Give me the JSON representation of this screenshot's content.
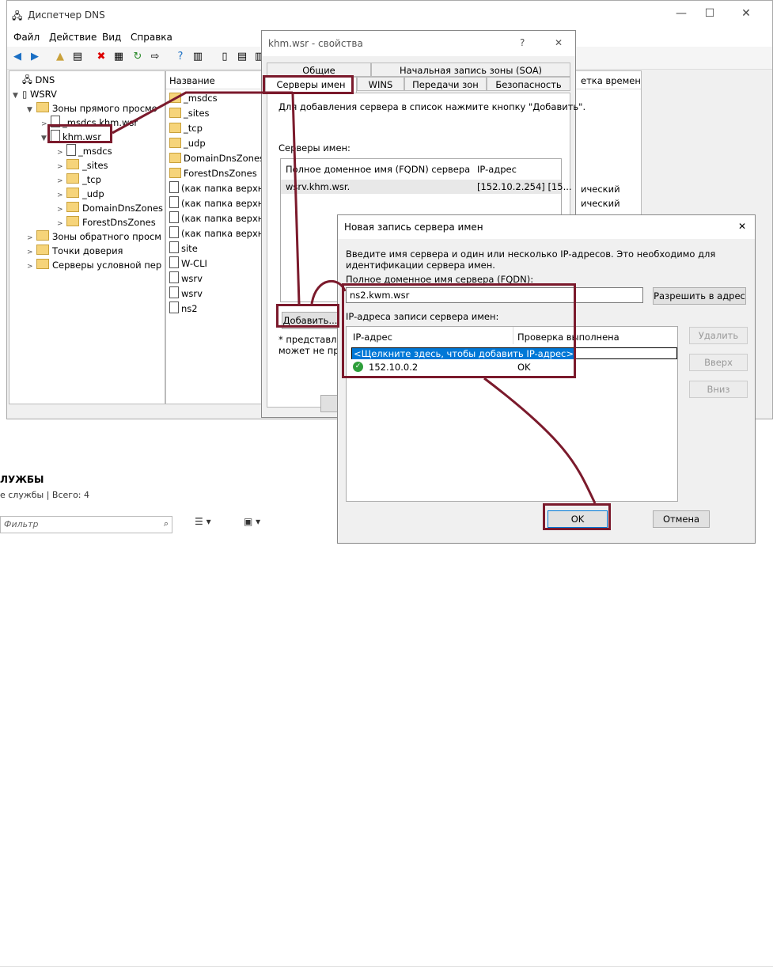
{
  "window": {
    "title": "Диспетчер DNS",
    "controls": {
      "minimize": "—",
      "maximize": "☐",
      "close": "✕"
    },
    "menu": [
      "Файл",
      "Действие",
      "Вид",
      "Справка"
    ]
  },
  "tree": {
    "items": [
      {
        "label": "DNS"
      },
      {
        "label": "WSRV"
      },
      {
        "label": "Зоны прямого просмо"
      },
      {
        "label": "_msdcs.khm.wsr"
      },
      {
        "label": "khm.wsr"
      },
      {
        "label": "_msdcs"
      },
      {
        "label": "_sites"
      },
      {
        "label": "_tcp"
      },
      {
        "label": "_udp"
      },
      {
        "label": "DomainDnsZones"
      },
      {
        "label": "ForestDnsZones"
      },
      {
        "label": "Зоны обратного просм"
      },
      {
        "label": "Точки доверия"
      },
      {
        "label": "Серверы условной пер"
      }
    ]
  },
  "list": {
    "header": "Название",
    "header_right": "етка времени",
    "items": [
      "_msdcs",
      "_sites",
      "_tcp",
      "_udp",
      "DomainDnsZones",
      "ForestDnsZones",
      "(как папка верхне",
      "(как папка верхне",
      "(как папка верхне",
      "(как папка верхне",
      "site",
      "W-CLI",
      "wsrv",
      "wsrv",
      "ns2"
    ],
    "right_text_1": "ический",
    "right_text_2": "ический"
  },
  "services": {
    "title": "ЛУЖБЫ",
    "subtitle": "е службы | Всего: 4",
    "filter_placeholder": "Фильтр"
  },
  "props": {
    "title": "khm.wsr - свойства",
    "help": "?",
    "close": "✕",
    "tabs_row1": [
      "Общие",
      "Начальная запись зоны (SOA)"
    ],
    "tabs_row2": [
      "Серверы имен",
      "WINS",
      "Передачи зон",
      "Безопасность"
    ],
    "instruction": "Для добавления сервера в список нажмите кнопку \"Добавить\".",
    "ns_label": "Серверы имен:",
    "col_fqdn": "Полное доменное имя (FQDN) сервера",
    "col_ip": "IP-адрес",
    "row_fqdn": "wsrv.khm.wsr.",
    "row_ip": "[152.10.2.254] [15...",
    "add_button": "Добавить...",
    "note_1": "* представляет",
    "note_2": "может не пред"
  },
  "nsd": {
    "title": "Новая запись сервера имен",
    "close": "✕",
    "description": "Введите имя сервера и один или несколько IP-адресов.  Это необходимо для идентификации сервера имен.",
    "fqdn_label": "Полное доменное имя сервера (FQDN):",
    "fqdn_value": "ns2.kwm.wsr",
    "resolve_button": "Разрешить в адрес",
    "ip_label": "IP-адреса записи сервера имен:",
    "col_ip": "IP-адрес",
    "col_check": "Проверка выполнена",
    "add_ip_prompt": "<Щелкните здесь, чтобы добавить IP-адрес>",
    "ip_value": "152.10.0.2",
    "ip_status": "OK",
    "delete_button": "Удалить",
    "up_button": "Вверх",
    "down_button": "Вниз",
    "ok_button": "OK",
    "cancel_button": "Отмена"
  },
  "colors": {
    "annotation": "#7b1a2c",
    "selection": "#0078d7"
  }
}
